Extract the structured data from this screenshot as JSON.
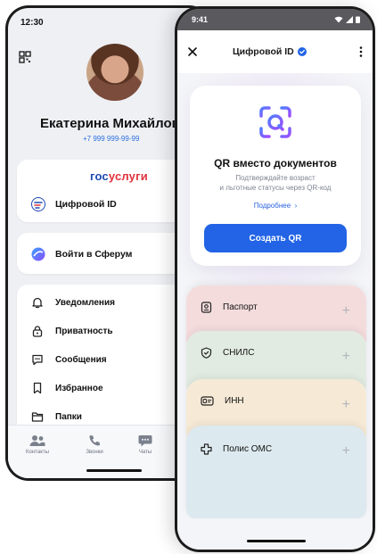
{
  "back_phone": {
    "time": "12:30",
    "profile": {
      "name": "Екатерина Михайлов",
      "phone": "+7 999 999-99-99"
    },
    "gosuslugi": {
      "logo_part1": "гос",
      "logo_part2": "услуги",
      "digital_id_label": "Цифровой ID"
    },
    "sferum_label": "Войти в Сферум",
    "menu": [
      {
        "label": "Уведомления",
        "icon": "bell-icon"
      },
      {
        "label": "Приватность",
        "icon": "lock-icon"
      },
      {
        "label": "Сообщения",
        "icon": "message-icon"
      },
      {
        "label": "Избранное",
        "icon": "bookmark-icon"
      },
      {
        "label": "Папки",
        "icon": "folder-icon"
      }
    ],
    "tabs": [
      {
        "label": "Контакты",
        "icon": "contacts-icon"
      },
      {
        "label": "Звонки",
        "icon": "phone-icon"
      },
      {
        "label": "Чаты",
        "icon": "chat-icon"
      }
    ]
  },
  "front_phone": {
    "time": "9:41",
    "header_title": "Цифровой ID",
    "qr_card": {
      "title": "QR вместо документов",
      "subtitle_line1": "Подтверждайте возраст",
      "subtitle_line2": "и льготные статусы через QR-код",
      "more_link": "Подробнее",
      "create_button": "Создать QR"
    },
    "documents": [
      {
        "label": "Паспорт",
        "icon": "passport-icon",
        "color": "#f4dcdd"
      },
      {
        "label": "СНИЛС",
        "icon": "shield-check-icon",
        "color": "#e2ebe2"
      },
      {
        "label": "ИНН",
        "icon": "id-card-icon",
        "color": "#f6ead6"
      },
      {
        "label": "Полис ОМС",
        "icon": "medical-cross-icon",
        "color": "#dce9ef"
      }
    ]
  },
  "colors": {
    "accent": "#2264e5",
    "gos_blue": "#1e4ab3",
    "gos_red": "#e1323b"
  }
}
